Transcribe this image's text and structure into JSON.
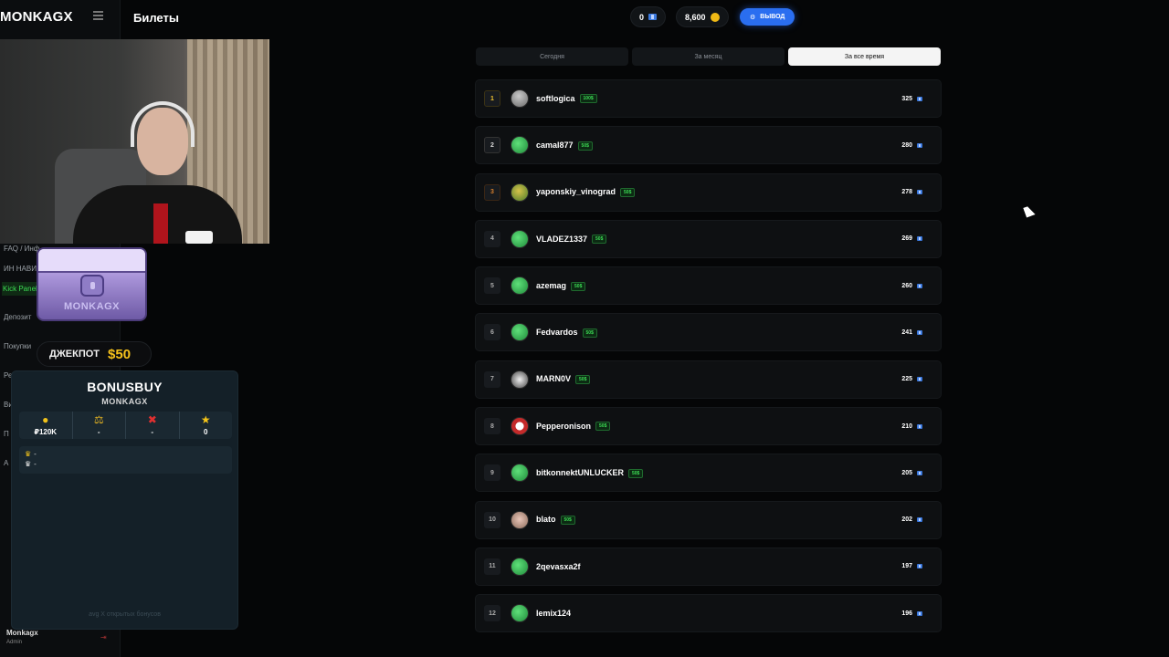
{
  "app": {
    "logo": "MONKAGX",
    "page_title": "Билеты"
  },
  "sidebar": {
    "items": [
      {
        "label": "FAQ / Инф"
      },
      {
        "label": "ИН НАВИ"
      },
      {
        "label": "Kick Panel",
        "active": true
      },
      {
        "label": "Депозит"
      },
      {
        "label": "Покупки"
      },
      {
        "label": "Ре"
      },
      {
        "label": "Ви"
      },
      {
        "label": "П"
      },
      {
        "label": "А"
      }
    ],
    "user": {
      "name": "Monkagx",
      "role": "Admin"
    }
  },
  "header": {
    "tickets": "0",
    "coins": "8,600",
    "withdraw_label": "ВЫВОД",
    "accent": "#2a6ef0"
  },
  "tabs": [
    {
      "label": "Сегодня",
      "active": false
    },
    {
      "label": "За месяц",
      "active": false
    },
    {
      "label": "За все время",
      "active": true
    }
  ],
  "leaderboard": [
    {
      "rank": "1",
      "name": "softlogica",
      "badge": "100$",
      "score": "325"
    },
    {
      "rank": "2",
      "name": "camal877",
      "badge": "50$",
      "score": "280"
    },
    {
      "rank": "3",
      "name": "yaponskiy_vinograd",
      "badge": "50$",
      "score": "278"
    },
    {
      "rank": "4",
      "name": "VLADEZ1337",
      "badge": "50$",
      "score": "269"
    },
    {
      "rank": "5",
      "name": "azemag",
      "badge": "50$",
      "score": "260"
    },
    {
      "rank": "6",
      "name": "Fedvardos",
      "badge": "50$",
      "score": "241"
    },
    {
      "rank": "7",
      "name": "MARN0V",
      "badge": "50$",
      "score": "225"
    },
    {
      "rank": "8",
      "name": "Pepperonison",
      "badge": "50$",
      "score": "210"
    },
    {
      "rank": "9",
      "name": "bitkonnektUNLUCKER",
      "badge": "50$",
      "score": "205"
    },
    {
      "rank": "10",
      "name": "blato",
      "badge": "50$",
      "score": "202"
    },
    {
      "rank": "11",
      "name": "2qevasxa2f",
      "badge": "",
      "score": "197"
    },
    {
      "rank": "12",
      "name": "lemix124",
      "badge": "",
      "score": "196"
    }
  ],
  "overlay": {
    "chest_text": "MONKAGX",
    "jackpot_label": "ДЖЕКПОТ",
    "jackpot_amount": "$50",
    "bonus": {
      "title": "BONUSBUY",
      "subtitle": "MONKAGX",
      "stats": [
        {
          "icon": "coin-icon",
          "value": "₽120K"
        },
        {
          "icon": "scales-icon",
          "value": "-"
        },
        {
          "icon": "cross-icon",
          "value": "-"
        },
        {
          "icon": "star-icon",
          "value": "0"
        }
      ],
      "crown_gold": "-",
      "crown_silver": "-",
      "footer": "avg X открытых бонусов"
    }
  }
}
